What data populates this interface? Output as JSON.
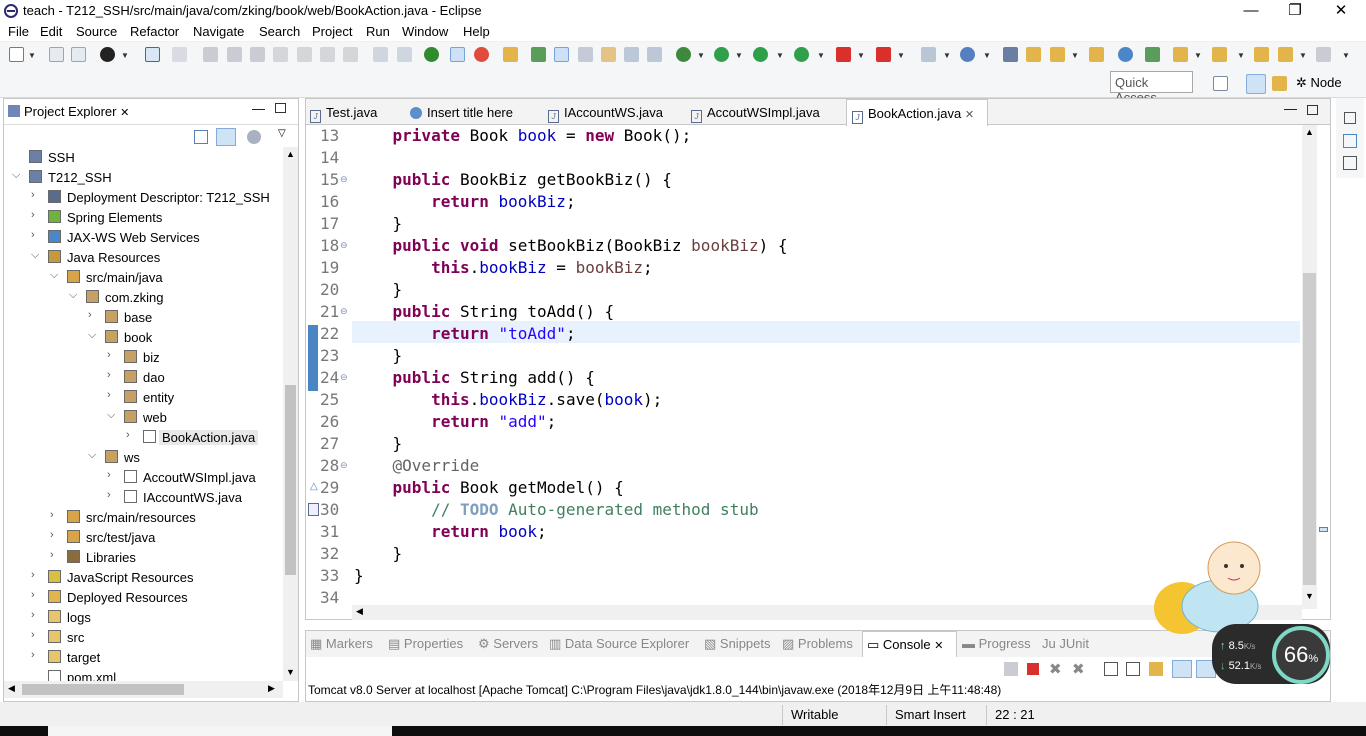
{
  "window": {
    "title": "teach - T212_SSH/src/main/java/com/zking/book/web/BookAction.java - Eclipse",
    "min": "—",
    "max": "❐",
    "close": "✕"
  },
  "menu": [
    "File",
    "Edit",
    "Source",
    "Refactor",
    "Navigate",
    "Search",
    "Project",
    "Run",
    "Window",
    "Help"
  ],
  "quick_access": "Quick Access",
  "perspective": "Node",
  "project_explorer": {
    "tab": "Project Explorer",
    "items": [
      {
        "label": "SSH",
        "depth": 0,
        "expanded": null,
        "icon": "project-icon"
      },
      {
        "label": "T212_SSH",
        "depth": 0,
        "expanded": true,
        "icon": "web-project-icon"
      },
      {
        "label": "Deployment Descriptor: T212_SSH",
        "depth": 1,
        "expanded": false,
        "icon": "descriptor-icon"
      },
      {
        "label": "Spring Elements",
        "depth": 1,
        "expanded": false,
        "icon": "spring-leaf-icon"
      },
      {
        "label": "JAX-WS Web Services",
        "depth": 1,
        "expanded": false,
        "icon": "webservice-icon"
      },
      {
        "label": "Java Resources",
        "depth": 1,
        "expanded": true,
        "icon": "java-resources-icon"
      },
      {
        "label": "src/main/java",
        "depth": 2,
        "expanded": true,
        "icon": "source-folder-icon"
      },
      {
        "label": "com.zking",
        "depth": 3,
        "expanded": true,
        "icon": "package-icon"
      },
      {
        "label": "base",
        "depth": 4,
        "expanded": false,
        "icon": "package-icon"
      },
      {
        "label": "book",
        "depth": 4,
        "expanded": true,
        "icon": "package-icon"
      },
      {
        "label": "biz",
        "depth": 5,
        "expanded": false,
        "icon": "package-icon"
      },
      {
        "label": "dao",
        "depth": 5,
        "expanded": false,
        "icon": "package-icon"
      },
      {
        "label": "entity",
        "depth": 5,
        "expanded": false,
        "icon": "package-icon"
      },
      {
        "label": "web",
        "depth": 5,
        "expanded": true,
        "icon": "package-icon"
      },
      {
        "label": "BookAction.java",
        "depth": 6,
        "expanded": false,
        "icon": "java-file-icon",
        "selected": true
      },
      {
        "label": "ws",
        "depth": 4,
        "expanded": true,
        "icon": "package-icon"
      },
      {
        "label": "AccoutWSImpl.java",
        "depth": 5,
        "expanded": false,
        "icon": "java-file-icon"
      },
      {
        "label": "IAccountWS.java",
        "depth": 5,
        "expanded": false,
        "icon": "java-interface-icon"
      },
      {
        "label": "src/main/resources",
        "depth": 2,
        "expanded": false,
        "icon": "source-folder-icon"
      },
      {
        "label": "src/test/java",
        "depth": 2,
        "expanded": false,
        "icon": "source-folder-icon"
      },
      {
        "label": "Libraries",
        "depth": 2,
        "expanded": false,
        "icon": "library-icon"
      },
      {
        "label": "JavaScript Resources",
        "depth": 1,
        "expanded": false,
        "icon": "js-resources-icon"
      },
      {
        "label": "Deployed Resources",
        "depth": 1,
        "expanded": false,
        "icon": "deployed-icon"
      },
      {
        "label": "logs",
        "depth": 1,
        "expanded": false,
        "icon": "folder-icon"
      },
      {
        "label": "src",
        "depth": 1,
        "expanded": false,
        "icon": "folder-icon"
      },
      {
        "label": "target",
        "depth": 1,
        "expanded": false,
        "icon": "folder-icon"
      },
      {
        "label": "pom.xml",
        "depth": 1,
        "expanded": null,
        "icon": "xml-file-icon"
      }
    ]
  },
  "editor_tabs": [
    {
      "label": "Test.java",
      "icon": "java-file-icon"
    },
    {
      "label": "Insert title here",
      "icon": "globe-icon"
    },
    {
      "label": "IAccountWS.java",
      "icon": "java-interface-icon"
    },
    {
      "label": "AccoutWSImpl.java",
      "icon": "java-file-icon"
    },
    {
      "label": "BookAction.java",
      "icon": "java-file-icon",
      "active": true,
      "close": "✕"
    }
  ],
  "code_lines": [
    {
      "n": "13",
      "fold": ""
    },
    {
      "n": "14",
      "fold": ""
    },
    {
      "n": "15",
      "fold": "⊖"
    },
    {
      "n": "16",
      "fold": ""
    },
    {
      "n": "17",
      "fold": ""
    },
    {
      "n": "18",
      "fold": "⊖"
    },
    {
      "n": "19",
      "fold": ""
    },
    {
      "n": "20",
      "fold": ""
    },
    {
      "n": "21",
      "fold": "⊖"
    },
    {
      "n": "22",
      "fold": ""
    },
    {
      "n": "23",
      "fold": ""
    },
    {
      "n": "24",
      "fold": "⊖"
    },
    {
      "n": "25",
      "fold": ""
    },
    {
      "n": "26",
      "fold": ""
    },
    {
      "n": "27",
      "fold": ""
    },
    {
      "n": "28",
      "fold": "⊖"
    },
    {
      "n": "29",
      "fold": ""
    },
    {
      "n": "30",
      "fold": ""
    },
    {
      "n": "31",
      "fold": ""
    },
    {
      "n": "32",
      "fold": ""
    },
    {
      "n": "33",
      "fold": ""
    },
    {
      "n": "34",
      "fold": ""
    }
  ],
  "code": {
    "l13": [
      "private",
      "Book",
      "book",
      "=",
      "new",
      "Book();"
    ],
    "l15": [
      "public",
      "BookBiz getBookBiz() {"
    ],
    "l16": [
      "return",
      "bookBiz",
      ";"
    ],
    "l17": [
      "}"
    ],
    "l18": [
      "public",
      "void",
      "setBookBiz(BookBiz ",
      "bookBiz",
      ") {"
    ],
    "l19": [
      "this",
      ".",
      "bookBiz",
      " = ",
      "bookBiz",
      ";"
    ],
    "l20": [
      "}"
    ],
    "l21": [
      "public",
      "String toAdd() {"
    ],
    "l22": [
      "return",
      "\"toAdd\"",
      ";"
    ],
    "l23": [
      "}"
    ],
    "l24": [
      "public",
      "String add() {"
    ],
    "l25": [
      "this",
      ".",
      "bookBiz",
      ".save(",
      "book",
      ");"
    ],
    "l26": [
      "return",
      "\"add\"",
      ";"
    ],
    "l27": [
      "}"
    ],
    "l28": [
      "@Override"
    ],
    "l29": [
      "public",
      "Book getModel() {"
    ],
    "l30": [
      "// ",
      "TODO",
      " Auto-generated method stub"
    ],
    "l31": [
      "return",
      "book",
      ";"
    ],
    "l32": [
      "}"
    ],
    "l33": [
      "}"
    ]
  },
  "bottom_tabs": [
    {
      "label": "Markers"
    },
    {
      "label": "Properties"
    },
    {
      "label": "Servers"
    },
    {
      "label": "Data Source Explorer"
    },
    {
      "label": "Snippets"
    },
    {
      "label": "Problems"
    },
    {
      "label": "Console",
      "active": true
    },
    {
      "label": "Progress"
    },
    {
      "label": "JUnit"
    }
  ],
  "console_text": "Tomcat v8.0 Server at localhost [Apache Tomcat] C:\\Program Files\\java\\jdk1.8.0_144\\bin\\javaw.exe (2018年12月9日 上午11:48:48)",
  "status": {
    "writable": "Writable",
    "insert": "Smart Insert",
    "position": "22 : 21"
  },
  "widget": {
    "percent": "66",
    "percent_sign": "%",
    "up": "8.5",
    "up_unit": "K/s",
    "down": "52.1",
    "down_unit": "K/s"
  }
}
